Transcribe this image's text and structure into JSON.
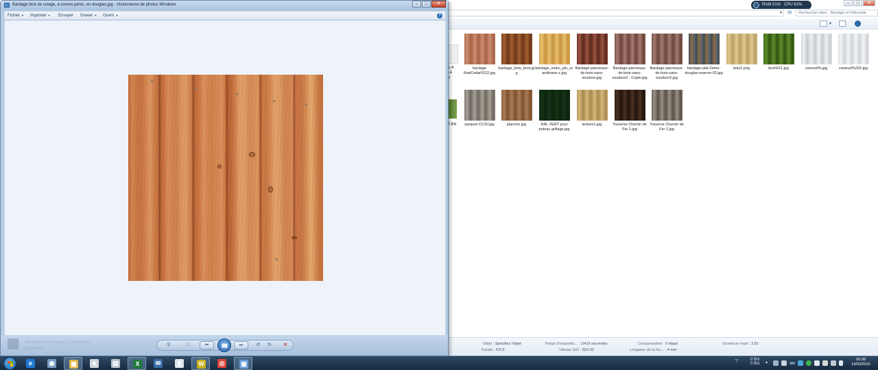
{
  "viewer": {
    "title": "Bardage brut de sciage, à couvre-joints, en douglas.jpg - Visionneuse de photos Windows",
    "menu": [
      {
        "label": "Fichier",
        "has_dropdown": true
      },
      {
        "label": "Imprimer",
        "has_dropdown": true
      },
      {
        "label": "Envoyer",
        "has_dropdown": false
      },
      {
        "label": "Graver",
        "has_dropdown": true
      },
      {
        "label": "Ouvrir",
        "has_dropdown": true
      }
    ],
    "help_label": "?",
    "controls": {
      "zoom": "⚲",
      "fit": "⊡",
      "prev": "⏮",
      "next": "⏭",
      "rotate_left": "↺",
      "rotate_right": "↻",
      "delete": "✕"
    },
    "window_controls": [
      "–",
      "□",
      "✕"
    ]
  },
  "explorer": {
    "search_placeholder": "Rechercher dans : Bardage et Palissade",
    "window_controls": [
      "–",
      "□",
      "✕"
    ],
    "row1": [
      {
        "label": "bardage RedCedar5222.jpg",
        "colors": [
          "#b06a4d",
          "#cf8f71",
          "#a9654a"
        ]
      },
      {
        "label": "bardage_bois_brun.jpg",
        "colors": [
          "#7a3f1f",
          "#a4602e",
          "#6f3819"
        ]
      },
      {
        "label": "bardage_ineko_pin_scandinave-z.jpg",
        "colors": [
          "#d3a24a",
          "#e7c070",
          "#c8923c"
        ]
      },
      {
        "label": "Bardage-panneaux-de-bois-sans-soudure.jpg",
        "colors": [
          "#6e3326",
          "#9c5442",
          "#5d2a1f"
        ]
      },
      {
        "label": "Bardage-panneaux-de-bois-sans-soudure2 - Copie.jpg",
        "colors": [
          "#7c5249",
          "#a77c70",
          "#6e453c"
        ]
      },
      {
        "label": "Bardage-panneaux-de-bois-sans-soudure2.jpg",
        "colors": [
          "#79524a",
          "#a57b6f",
          "#6c463d"
        ]
      },
      {
        "label": "bardage-plat-2eme-douglas-marron-02.jpg",
        "colors": [
          "#3e4a52",
          "#8a6c48",
          "#56616a"
        ]
      },
      {
        "label": "bois1.png",
        "colors": [
          "#c8ad74",
          "#e0c892",
          "#b99d62"
        ]
      },
      {
        "label": "bush011.jpg",
        "colors": [
          "#3e6a1a",
          "#5e8c2a",
          "#2f5212"
        ]
      },
      {
        "label": "canexel%.jpg",
        "colors": [
          "#d4d8dc",
          "#eef0f2",
          "#c6cbd0"
        ]
      },
      {
        "label": "canexel%202.jpg",
        "colors": [
          "#dde0e3",
          "#f3f4f5",
          "#cfd3d7"
        ]
      }
    ],
    "row2": [
      {
        "label": "parquet CC3V.jpg",
        "colors": [
          "#7f7870",
          "#a8a198",
          "#6e675f"
        ]
      },
      {
        "label": "planche.jpg",
        "colors": [
          "#8a5f3c",
          "#a97d57",
          "#7b5232"
        ]
      },
      {
        "label": "RAL VERT pour poteau grillage.jpg",
        "colors": [
          "#0f2a12",
          "#143516",
          "#0c230f"
        ]
      },
      {
        "label": "texture1.jpg",
        "colors": [
          "#b89a5e",
          "#d3b77b",
          "#a8894f"
        ]
      },
      {
        "label": "Traverse Chemin de Fer 1.jpg",
        "colors": [
          "#2c1c12",
          "#4a3222",
          "#22150d"
        ]
      },
      {
        "label": "Traverse Chemin de Fer 2.jpg",
        "colors": [
          "#6a6258",
          "#9a9186",
          "#5b544b"
        ]
      }
    ],
    "partial": {
      "row1_label": "E ALE g",
      "row2_label": "2.jpg"
    },
    "details": {
      "objet_label": "Objet :",
      "objet_value": "Spécifiez l'objet",
      "focale_label": "Focale :",
      "focale_value": "F/2.6",
      "temps_label": "Temps d'expositio... :",
      "temps_value": "1/419 secondes",
      "iso_label": "Vitesse ISO :",
      "iso_value": "ISO-32",
      "comp_label": "Compensation :",
      "comp_value": "0 étape",
      "longueur_label": "Longueur de la foc... :",
      "longueur_value": "4 mm",
      "ouverture_label": "Ouverture maxi :",
      "ouverture_value": "2.81",
      "left_fragment": "G"
    }
  },
  "sysmon": {
    "ram": "RAM 51%",
    "cpu": "CPU 61%"
  },
  "taskbar": {
    "apps": [
      {
        "name": "ie",
        "glyph": "e",
        "color": "#1f79d1"
      },
      {
        "name": "firefox",
        "glyph": "◉",
        "color": "#7a9ec6"
      },
      {
        "name": "explorer",
        "glyph": "▦",
        "color": "#e2b54a"
      },
      {
        "name": "messenger",
        "glyph": "☻",
        "color": "#cfd6de"
      },
      {
        "name": "calculator",
        "glyph": "▤",
        "color": "#b9c3cc"
      },
      {
        "name": "excel",
        "glyph": "X",
        "color": "#1d7a3a"
      },
      {
        "name": "thunderbird",
        "glyph": "✉",
        "color": "#3a6ea8"
      },
      {
        "name": "notes",
        "glyph": "▮",
        "color": "#dfe6ee"
      },
      {
        "name": "w-app",
        "glyph": "W",
        "color": "#c9b215"
      },
      {
        "name": "chrome",
        "glyph": "◎",
        "color": "#d9453a"
      },
      {
        "name": "photo-viewer",
        "glyph": "▣",
        "color": "#6aa2d8"
      }
    ],
    "net_up": "0 B/s",
    "net_down": "0 B/s",
    "time": "05:08",
    "date": "14/03/2015"
  },
  "viewer_status": {
    "filename": "Bardage brut de sciage, à couvre-joint...",
    "line2": "Cliché ISO"
  }
}
